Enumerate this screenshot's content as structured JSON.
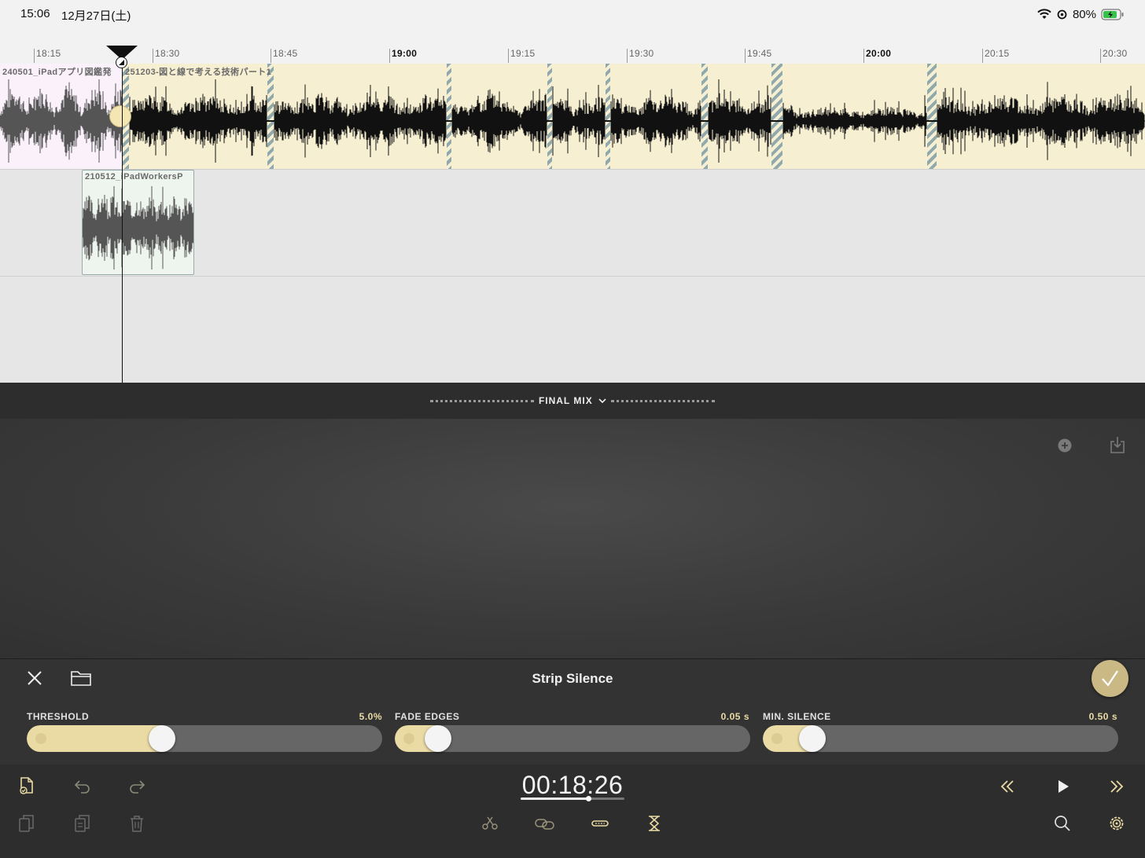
{
  "status_bar": {
    "time": "15:06",
    "date": "12月27日(土)",
    "battery": "80%"
  },
  "ruler": {
    "ticks": [
      {
        "label": "18:15",
        "major": false
      },
      {
        "label": "18:30",
        "major": false
      },
      {
        "label": "18:45",
        "major": false
      },
      {
        "label": "19:00",
        "major": true
      },
      {
        "label": "19:15",
        "major": false
      },
      {
        "label": "19:30",
        "major": false
      },
      {
        "label": "19:45",
        "major": false
      },
      {
        "label": "20:00",
        "major": true
      },
      {
        "label": "20:15",
        "major": false
      },
      {
        "label": "20:30",
        "major": false
      }
    ]
  },
  "tracks": {
    "clip_a_name": "240501_iPadアプリ図鑑発",
    "clip_b_name": "251203-図と線で考える技術パート1",
    "clip_c_name": "210512_iPadWorkersP"
  },
  "mixer": {
    "title": "FINAL MIX"
  },
  "strip_silence": {
    "title": "Strip Silence",
    "threshold": {
      "label": "THRESHOLD",
      "value": "5.0%",
      "level": 0.37
    },
    "fade_edges": {
      "label": "FADE EDGES",
      "value": "0.05 s",
      "level": 0.09
    },
    "min_silence": {
      "label": "MIN. SILENCE",
      "value": "0.50 s",
      "level": 0.11
    }
  },
  "transport": {
    "timecode": "00:18:26",
    "progress": 0.65
  },
  "colors": {
    "accent": "#eadba5",
    "clip_b_bg": "#f6efd2",
    "clip_a_bg": "#fbf1fa",
    "silence_marker": "#8fa9ad",
    "panel_bg": "#333333"
  }
}
